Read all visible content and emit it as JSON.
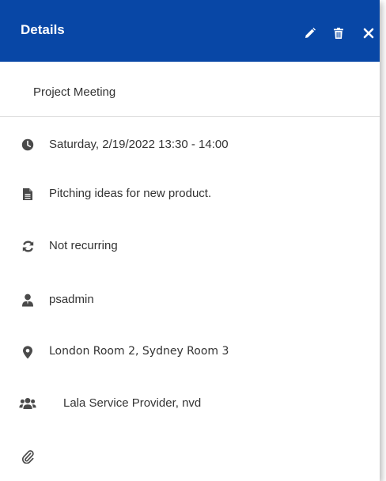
{
  "header": {
    "title": "Details",
    "background": "#0847a6",
    "actions": [
      {
        "name": "edit",
        "icon": "pencil-icon"
      },
      {
        "name": "delete",
        "icon": "trash-icon"
      },
      {
        "name": "close",
        "icon": "close-icon"
      }
    ]
  },
  "event": {
    "subject": "Project Meeting",
    "datetime": "Saturday, 2/19/2022 13:30 - 14:00",
    "description": "Pitching ideas for new product.",
    "recurrence": "Not recurring",
    "organizer": "psadmin",
    "location": "London Room 2, Sydney Room 3",
    "attendees": "Lala Service Provider, nvd",
    "attachments": ""
  },
  "icons": {
    "datetime": "clock-icon",
    "description": "document-icon",
    "recurrence": "refresh-icon",
    "organizer": "user-icon",
    "location": "map-pin-icon",
    "attendees": "users-icon",
    "attachments": "paperclip-icon"
  }
}
